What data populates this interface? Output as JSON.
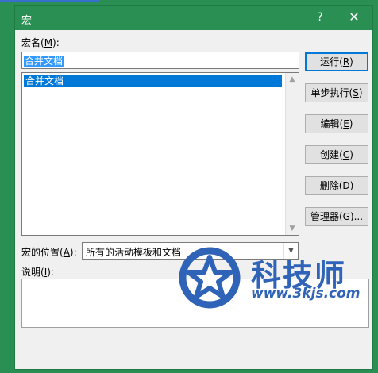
{
  "dialog": {
    "title": "宏",
    "help_glyph": "?",
    "close_glyph": "✕"
  },
  "macro_name": {
    "label_text": "宏名(",
    "label_key": "M",
    "label_end": "):",
    "value": "合并文档"
  },
  "macro_list": {
    "items": [
      "合并文档"
    ]
  },
  "buttons": {
    "run": {
      "text": "运行(",
      "key": "R",
      "end": ")"
    },
    "step": {
      "text": "单步执行(",
      "key": "S",
      "end": ")"
    },
    "edit": {
      "text": "编辑(",
      "key": "E",
      "end": ")"
    },
    "create": {
      "text": "创建(",
      "key": "C",
      "end": ")"
    },
    "delete": {
      "text": "删除(",
      "key": "D",
      "end": ")"
    },
    "organizer": {
      "text": "管理器(",
      "key": "G",
      "end": ")..."
    }
  },
  "location": {
    "label_text": "宏的位置(",
    "label_key": "A",
    "label_end": "):",
    "value": "所有的活动模板和文档"
  },
  "description": {
    "label_text": "说明(",
    "label_key": "I",
    "label_end": "):"
  },
  "watermark": {
    "brand": "科技师",
    "url": "www.3kjs.com"
  },
  "colors": {
    "titlebar": "#2a8f52",
    "selection": "#0078d7",
    "watermark": "#2f63b8"
  }
}
